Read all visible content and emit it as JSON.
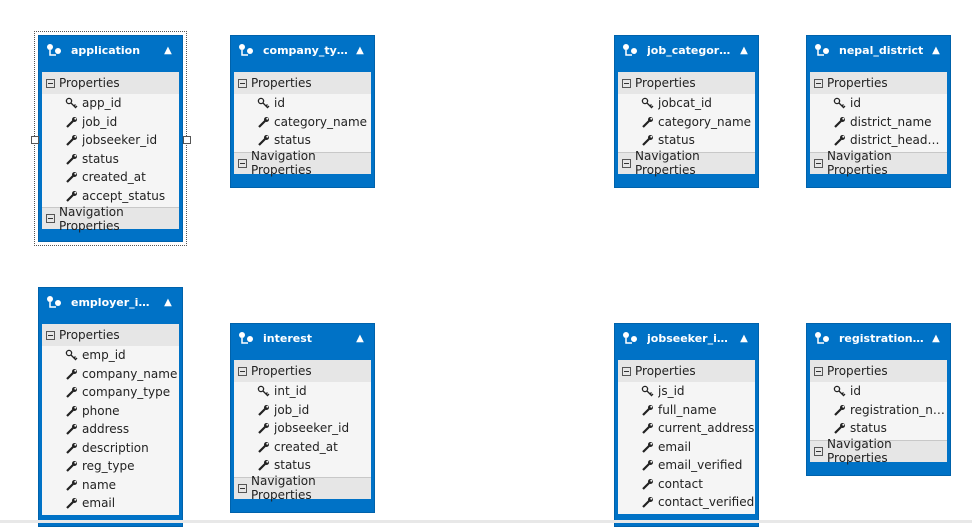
{
  "section_labels": {
    "properties": "Properties",
    "navigation": "Navigation Properties"
  },
  "entities": {
    "application": {
      "title": "application",
      "props": [
        {
          "name": "app_id",
          "key": true
        },
        {
          "name": "job_id"
        },
        {
          "name": "jobseeker_id"
        },
        {
          "name": "status"
        },
        {
          "name": "created_at"
        },
        {
          "name": "accept_status"
        }
      ]
    },
    "company_type": {
      "title": "company_type",
      "props": [
        {
          "name": "id",
          "key": true
        },
        {
          "name": "category_name"
        },
        {
          "name": "status"
        }
      ]
    },
    "job_categories": {
      "title": "job_categories",
      "props": [
        {
          "name": "jobcat_id",
          "key": true
        },
        {
          "name": "category_name"
        },
        {
          "name": "status"
        }
      ]
    },
    "nepal_district": {
      "title": "nepal_district",
      "props": [
        {
          "name": "id",
          "key": true
        },
        {
          "name": "district_name"
        },
        {
          "name": "district_headqua..."
        }
      ]
    },
    "employer_info": {
      "title": "employer_info",
      "props": [
        {
          "name": "emp_id",
          "key": true
        },
        {
          "name": "company_name"
        },
        {
          "name": "company_type"
        },
        {
          "name": "phone"
        },
        {
          "name": "address"
        },
        {
          "name": "description"
        },
        {
          "name": "reg_type"
        },
        {
          "name": "name"
        },
        {
          "name": "email"
        }
      ]
    },
    "interest": {
      "title": "interest",
      "props": [
        {
          "name": "int_id",
          "key": true
        },
        {
          "name": "job_id"
        },
        {
          "name": "jobseeker_id"
        },
        {
          "name": "created_at"
        },
        {
          "name": "status"
        }
      ]
    },
    "jobseeker_info": {
      "title": "jobseeker_info",
      "props": [
        {
          "name": "js_id",
          "key": true
        },
        {
          "name": "full_name"
        },
        {
          "name": "current_address"
        },
        {
          "name": "email"
        },
        {
          "name": "email_verified"
        },
        {
          "name": "contact"
        },
        {
          "name": "contact_verified"
        }
      ]
    },
    "registration_type": {
      "title": "registration_t...",
      "props": [
        {
          "name": "id",
          "key": true
        },
        {
          "name": "registration_name"
        },
        {
          "name": "status"
        }
      ]
    }
  }
}
